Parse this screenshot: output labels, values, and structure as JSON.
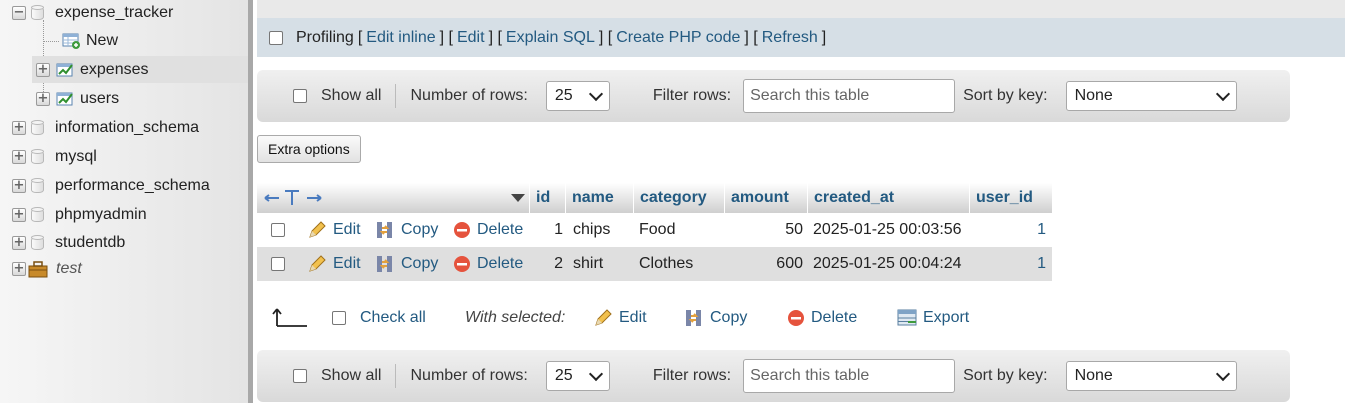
{
  "nav": {
    "tree": [
      {
        "label": "expense_tracker",
        "state": "expanded"
      },
      {
        "label": "New"
      },
      {
        "label": "expenses"
      },
      {
        "label": "users"
      },
      {
        "label": "information_schema"
      },
      {
        "label": "mysql"
      },
      {
        "label": "performance_schema"
      },
      {
        "label": "phpmyadmin"
      },
      {
        "label": "studentdb"
      },
      {
        "label": "test"
      }
    ]
  },
  "profiling": {
    "label": "Profiling",
    "links": [
      {
        "label": "Edit inline"
      },
      {
        "label": "Edit"
      },
      {
        "label": "Explain SQL"
      },
      {
        "label": "Create PHP code"
      },
      {
        "label": "Refresh"
      }
    ],
    "open": "[",
    "mid": "] [",
    "close": "]"
  },
  "table_nav": {
    "show_all": "Show all",
    "rows_label": "Number of rows:",
    "rows_value": "25",
    "filter_label": "Filter rows:",
    "filter_placeholder": "Search this table",
    "sort_label": "Sort by key:",
    "sort_value": "None"
  },
  "extra_options": "Extra options",
  "results": {
    "columns": [
      "id",
      "name",
      "category",
      "amount",
      "created_at",
      "user_id"
    ],
    "row_actions": {
      "edit": "Edit",
      "copy": "Copy",
      "delete": "Delete"
    },
    "rows": [
      {
        "id": "1",
        "name": "chips",
        "category": "Food",
        "amount": "50",
        "created_at": "2025-01-25 00:03:56",
        "user_id": "1"
      },
      {
        "id": "2",
        "name": "shirt",
        "category": "Clothes",
        "amount": "600",
        "created_at": "2025-01-25 00:04:24",
        "user_id": "1"
      }
    ]
  },
  "bulk": {
    "check_all": "Check all",
    "with_selected": "With selected:",
    "edit": "Edit",
    "copy": "Copy",
    "delete": "Delete",
    "export": "Export"
  }
}
